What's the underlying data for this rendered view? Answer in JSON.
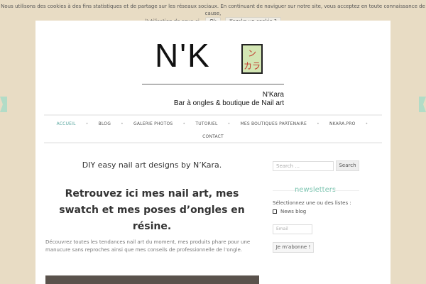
{
  "cookie": {
    "text_line1": "Nous utilisons des cookies à des fins statistiques et de partage sur les réseaux sociaux. En continuant de naviguer sur notre site, vous acceptez en toute connaissance de cause,",
    "text_line2": "l'utilisation de ceux-ci.",
    "ok_label": "Ok",
    "more_label": "Kezako un cookie ?"
  },
  "logo": {
    "brand": "N'K",
    "jp_text_1": "ン",
    "jp_text_2": "カラ",
    "caption_line1": "N'Kara",
    "caption_line2": "Bar à ongles & boutique de Nail art"
  },
  "nav": {
    "row1": [
      "ACCUEIL",
      "BLOG",
      "GALERIE PHOTOS",
      "TUTORIEL",
      "MES BOUTIQUES PARTENAIRE",
      "NKARA.PRO"
    ],
    "row2": [
      "CONTACT"
    ],
    "active": "ACCUEIL"
  },
  "main": {
    "post_title": "DIY easy nail art designs by N’Kara.",
    "headline": "Retrouvez ici mes nail art, mes swatch et mes poses d’ongles en résine.",
    "intro": "Découvrez toutes les tendances nail art du moment, mes produits phare pour une manucure sans reproches ainsi que mes conseils de professionnelle de l’ongle."
  },
  "sidebar": {
    "search_placeholder": "Search ...",
    "search_button": "Search",
    "newsletter_title": "newsletters",
    "list_label": "Sélectionnez une ou des listes :",
    "list_option": "News blog",
    "email_placeholder": "Email",
    "subscribe_label": "Je m'abonne !"
  },
  "colors": {
    "background": "#e8dcc4",
    "accent": "#7cc4b0",
    "ribbon": "#b2dcc7",
    "active_nav": "#5aa7a0"
  }
}
